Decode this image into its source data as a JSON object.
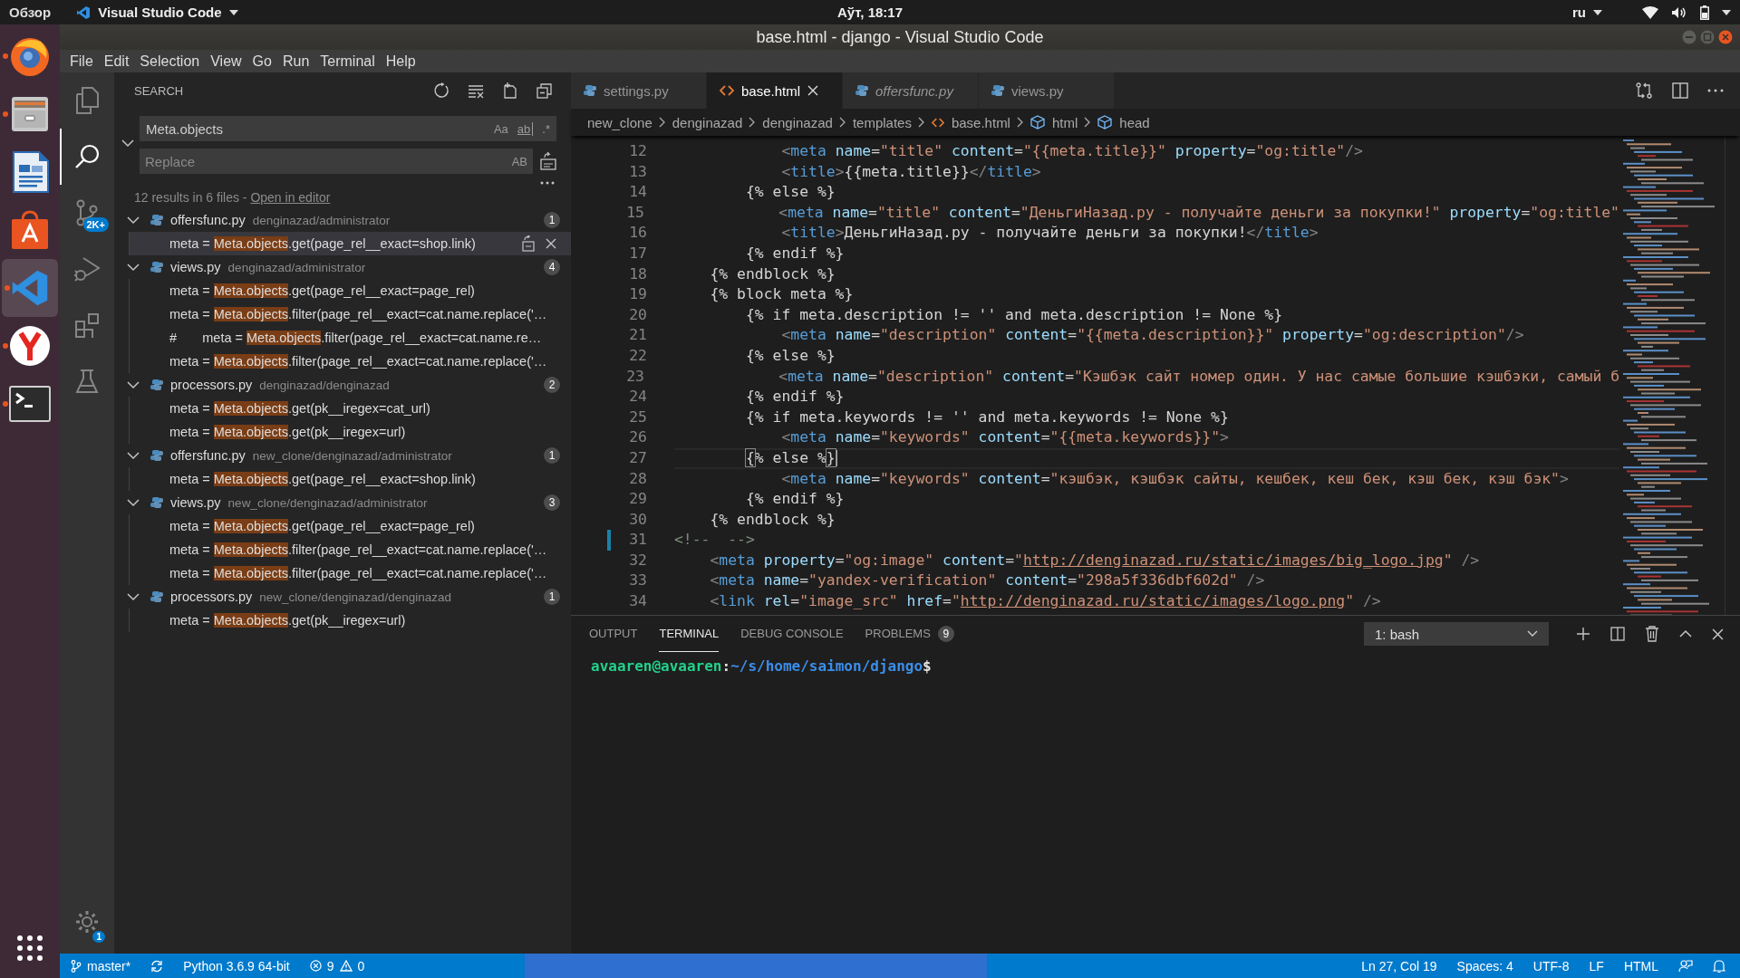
{
  "top_bar": {
    "activities": "Обзор",
    "app_menu": "Visual Studio Code",
    "clock": "Аўт, 18:17",
    "keyboard_layout": "ru"
  },
  "dock": [
    {
      "kind": "browser",
      "running": true,
      "selected": false
    },
    {
      "kind": "files",
      "running": true,
      "selected": false
    },
    {
      "kind": "writer",
      "running": false,
      "selected": false
    },
    {
      "kind": "store",
      "running": false,
      "selected": false
    },
    {
      "kind": "editor",
      "running": true,
      "selected": true
    },
    {
      "kind": "browser2",
      "running": true,
      "selected": false
    },
    {
      "kind": "terminal",
      "running": true,
      "selected": false
    }
  ],
  "window": {
    "title": "base.html - django - Visual Studio Code"
  },
  "menu": [
    "File",
    "Edit",
    "Selection",
    "View",
    "Go",
    "Run",
    "Terminal",
    "Help"
  ],
  "activity_bar": [
    {
      "kind": "explorer",
      "selected": false
    },
    {
      "kind": "search",
      "selected": true
    },
    {
      "kind": "source_control",
      "selected": false,
      "badge": "2K+"
    },
    {
      "kind": "run",
      "selected": false
    },
    {
      "kind": "extensions",
      "selected": false
    },
    {
      "kind": "testing",
      "selected": false
    }
  ],
  "manage_badge": "1",
  "search": {
    "title": "SEARCH",
    "query": "Meta.objects",
    "case_option": "Aa",
    "word_option": "ab",
    "regex_option": ".*",
    "replace_placeholder": "Replace",
    "preserve_case_option": "AB",
    "summary": "12 results in 6 files - ",
    "open_link": "Open in editor",
    "groups": [
      {
        "file": "offersfunc.py",
        "path": "denginazad/administrator",
        "count": "1",
        "expanded": true,
        "matches": [
          {
            "prefix": "meta = ",
            "match": "Meta.objects",
            "suffix": ".get(page_rel__exact=shop.link)",
            "selected": true
          }
        ]
      },
      {
        "file": "views.py",
        "path": "denginazad/administrator",
        "count": "4",
        "expanded": true,
        "matches": [
          {
            "prefix": "meta = ",
            "match": "Meta.objects",
            "suffix": ".get(page_rel__exact=page_rel)",
            "selected": false
          },
          {
            "prefix": "meta = ",
            "match": "Meta.objects",
            "suffix": ".filter(page_rel__exact=cat.name.replace('…",
            "selected": false
          },
          {
            "prefix": "#       meta = ",
            "match": "Meta.objects",
            "suffix": ".filter(page_rel__exact=cat.name.re…",
            "selected": false
          },
          {
            "prefix": "meta = ",
            "match": "Meta.objects",
            "suffix": ".filter(page_rel__exact=cat.name.replace('…",
            "selected": false
          }
        ]
      },
      {
        "file": "processors.py",
        "path": "denginazad/denginazad",
        "count": "2",
        "expanded": true,
        "matches": [
          {
            "prefix": "meta = ",
            "match": "Meta.objects",
            "suffix": ".get(pk__iregex=cat_url)",
            "selected": false
          },
          {
            "prefix": "meta = ",
            "match": "Meta.objects",
            "suffix": ".get(pk__iregex=url)",
            "selected": false
          }
        ]
      },
      {
        "file": "offersfunc.py",
        "path": "new_clone/denginazad/administrator",
        "count": "1",
        "expanded": true,
        "matches": [
          {
            "prefix": "meta = ",
            "match": "Meta.objects",
            "suffix": ".get(page_rel__exact=shop.link)",
            "selected": false
          }
        ]
      },
      {
        "file": "views.py",
        "path": "new_clone/denginazad/administrator",
        "count": "3",
        "expanded": true,
        "matches": [
          {
            "prefix": "meta = ",
            "match": "Meta.objects",
            "suffix": ".get(page_rel__exact=page_rel)",
            "selected": false
          },
          {
            "prefix": "meta = ",
            "match": "Meta.objects",
            "suffix": ".filter(page_rel__exact=cat.name.replace('…",
            "selected": false
          },
          {
            "prefix": "meta = ",
            "match": "Meta.objects",
            "suffix": ".filter(page_rel__exact=cat.name.replace('…",
            "selected": false
          }
        ]
      },
      {
        "file": "processors.py",
        "path": "new_clone/denginazad/denginazad",
        "count": "1",
        "expanded": true,
        "matches": [
          {
            "prefix": "meta = ",
            "match": "Meta.objects",
            "suffix": ".get(pk__iregex=url)",
            "selected": false
          }
        ]
      }
    ]
  },
  "tabs": [
    {
      "label": "settings.py",
      "kind": "python",
      "selected": false,
      "preview": false
    },
    {
      "label": "base.html",
      "kind": "html",
      "selected": true,
      "preview": false
    },
    {
      "label": "offersfunc.py",
      "kind": "python",
      "selected": false,
      "preview": true
    },
    {
      "label": "views.py",
      "kind": "python",
      "selected": false,
      "preview": false
    }
  ],
  "breadcrumbs": [
    {
      "label": "new_clone",
      "kind": "folder"
    },
    {
      "label": "denginazad",
      "kind": "folder"
    },
    {
      "label": "denginazad",
      "kind": "folder"
    },
    {
      "label": "templates",
      "kind": "folder"
    },
    {
      "label": "base.html",
      "kind": "html"
    },
    {
      "label": "html",
      "kind": "element"
    },
    {
      "label": "head",
      "kind": "element"
    }
  ],
  "editor": {
    "lines": [
      {
        "number": "12",
        "current": false,
        "changed": false,
        "tokens": [
          {
            "kind": "punct",
            "text": "            <"
          },
          {
            "kind": "tag",
            "text": "meta"
          },
          {
            "kind": "attr",
            "text": " name"
          },
          {
            "kind": "text",
            "text": "="
          },
          {
            "kind": "string",
            "text": "\"title\""
          },
          {
            "kind": "attr",
            "text": " content"
          },
          {
            "kind": "text",
            "text": "="
          },
          {
            "kind": "string",
            "text": "\"{{meta.title}}\""
          },
          {
            "kind": "attr",
            "text": " property"
          },
          {
            "kind": "text",
            "text": "="
          },
          {
            "kind": "string",
            "text": "\"og:title\""
          },
          {
            "kind": "punct",
            "text": "/>"
          }
        ]
      },
      {
        "number": "13",
        "current": false,
        "changed": false,
        "tokens": [
          {
            "kind": "punct",
            "text": "            <"
          },
          {
            "kind": "tag",
            "text": "title"
          },
          {
            "kind": "punct",
            "text": ">"
          },
          {
            "kind": "text",
            "text": "{{meta.title}}"
          },
          {
            "kind": "punct",
            "text": "</"
          },
          {
            "kind": "tag",
            "text": "title"
          },
          {
            "kind": "punct",
            "text": ">"
          }
        ]
      },
      {
        "number": "14",
        "current": false,
        "changed": false,
        "tokens": [
          {
            "kind": "text",
            "text": "        {% else %}"
          }
        ]
      },
      {
        "number": "15",
        "current": false,
        "changed": false,
        "tokens": [
          {
            "kind": "punct",
            "text": "            <"
          },
          {
            "kind": "tag",
            "text": "meta"
          },
          {
            "kind": "attr",
            "text": " name"
          },
          {
            "kind": "text",
            "text": "="
          },
          {
            "kind": "string",
            "text": "\"title\""
          },
          {
            "kind": "attr",
            "text": " content"
          },
          {
            "kind": "text",
            "text": "="
          },
          {
            "kind": "string",
            "text": "\"ДеньгиНазад.ру - получайте деньги за покупки!\""
          },
          {
            "kind": "attr",
            "text": " property"
          },
          {
            "kind": "text",
            "text": "="
          },
          {
            "kind": "string",
            "text": "\"og:title\""
          }
        ]
      },
      {
        "number": "16",
        "current": false,
        "changed": false,
        "tokens": [
          {
            "kind": "punct",
            "text": "            <"
          },
          {
            "kind": "tag",
            "text": "title"
          },
          {
            "kind": "punct",
            "text": ">"
          },
          {
            "kind": "text",
            "text": "ДеньгиНазад.ру - получайте деньги за покупки!"
          },
          {
            "kind": "punct",
            "text": "</"
          },
          {
            "kind": "tag",
            "text": "title"
          },
          {
            "kind": "punct",
            "text": ">"
          }
        ]
      },
      {
        "number": "17",
        "current": false,
        "changed": false,
        "tokens": [
          {
            "kind": "text",
            "text": "        {% endif %}"
          }
        ]
      },
      {
        "number": "18",
        "current": false,
        "changed": false,
        "tokens": [
          {
            "kind": "text",
            "text": "    {% endblock %}"
          }
        ]
      },
      {
        "number": "19",
        "current": false,
        "changed": false,
        "tokens": [
          {
            "kind": "text",
            "text": "    {% block meta %}"
          }
        ]
      },
      {
        "number": "20",
        "current": false,
        "changed": false,
        "tokens": [
          {
            "kind": "text",
            "text": "        {% if meta.description != '' and meta.description != None %}"
          }
        ]
      },
      {
        "number": "21",
        "current": false,
        "changed": false,
        "tokens": [
          {
            "kind": "punct",
            "text": "            <"
          },
          {
            "kind": "tag",
            "text": "meta"
          },
          {
            "kind": "attr",
            "text": " name"
          },
          {
            "kind": "text",
            "text": "="
          },
          {
            "kind": "string",
            "text": "\"description\""
          },
          {
            "kind": "attr",
            "text": " content"
          },
          {
            "kind": "text",
            "text": "="
          },
          {
            "kind": "string",
            "text": "\"{{meta.description}}\""
          },
          {
            "kind": "attr",
            "text": " property"
          },
          {
            "kind": "text",
            "text": "="
          },
          {
            "kind": "string",
            "text": "\"og:description\""
          },
          {
            "kind": "punct",
            "text": "/>"
          }
        ]
      },
      {
        "number": "22",
        "current": false,
        "changed": false,
        "tokens": [
          {
            "kind": "text",
            "text": "        {% else %}"
          }
        ]
      },
      {
        "number": "23",
        "current": false,
        "changed": false,
        "tokens": [
          {
            "kind": "punct",
            "text": "            <"
          },
          {
            "kind": "tag",
            "text": "meta"
          },
          {
            "kind": "attr",
            "text": " name"
          },
          {
            "kind": "text",
            "text": "="
          },
          {
            "kind": "string",
            "text": "\"description\""
          },
          {
            "kind": "attr",
            "text": " content"
          },
          {
            "kind": "text",
            "text": "="
          },
          {
            "kind": "string",
            "text": "\"Кэшбэк сайт номер один. У нас самые большие кэшбэки, самый б"
          }
        ]
      },
      {
        "number": "24",
        "current": false,
        "changed": false,
        "tokens": [
          {
            "kind": "text",
            "text": "        {% endif %}"
          }
        ]
      },
      {
        "number": "25",
        "current": false,
        "changed": false,
        "tokens": [
          {
            "kind": "text",
            "text": "        {% if meta.keywords != '' and meta.keywords != None %}"
          }
        ]
      },
      {
        "number": "26",
        "current": false,
        "changed": false,
        "tokens": [
          {
            "kind": "punct",
            "text": "            <"
          },
          {
            "kind": "tag",
            "text": "meta"
          },
          {
            "kind": "attr",
            "text": " name"
          },
          {
            "kind": "text",
            "text": "="
          },
          {
            "kind": "string",
            "text": "\"keywords\""
          },
          {
            "kind": "attr",
            "text": " content"
          },
          {
            "kind": "text",
            "text": "="
          },
          {
            "kind": "string",
            "text": "\"{{meta.keywords}}\""
          },
          {
            "kind": "punct",
            "text": ">"
          }
        ]
      },
      {
        "number": "27",
        "current": true,
        "changed": false,
        "tokens": [
          {
            "kind": "bracket",
            "text": "        {"
          },
          {
            "kind": "text",
            "text": "% else %"
          },
          {
            "kind": "bracket",
            "text": "}"
          }
        ]
      },
      {
        "number": "28",
        "current": false,
        "changed": false,
        "tokens": [
          {
            "kind": "punct",
            "text": "            <"
          },
          {
            "kind": "tag",
            "text": "meta"
          },
          {
            "kind": "attr",
            "text": " name"
          },
          {
            "kind": "text",
            "text": "="
          },
          {
            "kind": "string",
            "text": "\"keywords\""
          },
          {
            "kind": "attr",
            "text": " content"
          },
          {
            "kind": "text",
            "text": "="
          },
          {
            "kind": "string",
            "text": "\"кэшбэк, кэшбэк сайты, кешбек, кеш бек, кэш бек, кэш бэк\""
          },
          {
            "kind": "punct",
            "text": ">"
          }
        ]
      },
      {
        "number": "29",
        "current": false,
        "changed": false,
        "tokens": [
          {
            "kind": "text",
            "text": "        {% endif %}"
          }
        ]
      },
      {
        "number": "30",
        "current": false,
        "changed": false,
        "tokens": [
          {
            "kind": "text",
            "text": "    {% endblock %}"
          }
        ]
      },
      {
        "number": "31",
        "current": false,
        "changed": true,
        "tokens": [
          {
            "kind": "comment",
            "text": "<!--  -->"
          }
        ]
      },
      {
        "number": "32",
        "current": false,
        "changed": false,
        "tokens": [
          {
            "kind": "punct",
            "text": "    <"
          },
          {
            "kind": "tag",
            "text": "meta"
          },
          {
            "kind": "attr",
            "text": " property"
          },
          {
            "kind": "text",
            "text": "="
          },
          {
            "kind": "string",
            "text": "\"og:image\""
          },
          {
            "kind": "attr",
            "text": " content"
          },
          {
            "kind": "text",
            "text": "="
          },
          {
            "kind": "string",
            "text": "\""
          },
          {
            "kind": "link",
            "text": "http://denginazad.ru/static/images/big_logo.jpg"
          },
          {
            "kind": "string",
            "text": "\""
          },
          {
            "kind": "punct",
            "text": " />"
          }
        ]
      },
      {
        "number": "33",
        "current": false,
        "changed": false,
        "tokens": [
          {
            "kind": "punct",
            "text": "    <"
          },
          {
            "kind": "tag",
            "text": "meta"
          },
          {
            "kind": "attr",
            "text": " name"
          },
          {
            "kind": "text",
            "text": "="
          },
          {
            "kind": "string",
            "text": "\"yandex-verification\""
          },
          {
            "kind": "attr",
            "text": " content"
          },
          {
            "kind": "text",
            "text": "="
          },
          {
            "kind": "string",
            "text": "\"298a5f336dbf602d\""
          },
          {
            "kind": "punct",
            "text": " />"
          }
        ]
      },
      {
        "number": "34",
        "current": false,
        "changed": false,
        "tokens": [
          {
            "kind": "punct",
            "text": "    <"
          },
          {
            "kind": "tag",
            "text": "link"
          },
          {
            "kind": "attr",
            "text": " rel"
          },
          {
            "kind": "text",
            "text": "="
          },
          {
            "kind": "string",
            "text": "\"image_src\""
          },
          {
            "kind": "attr",
            "text": " href"
          },
          {
            "kind": "text",
            "text": "="
          },
          {
            "kind": "string",
            "text": "\""
          },
          {
            "kind": "link",
            "text": "http://denginazad.ru/static/images/logo.png"
          },
          {
            "kind": "string",
            "text": "\""
          },
          {
            "kind": "punct",
            "text": " />"
          }
        ]
      }
    ]
  },
  "panel": {
    "tabs": [
      {
        "label": "OUTPUT",
        "selected": false
      },
      {
        "label": "TERMINAL",
        "selected": true
      },
      {
        "label": "DEBUG CONSOLE",
        "selected": false
      },
      {
        "label": "PROBLEMS",
        "selected": false,
        "badge": "9"
      }
    ],
    "terminal_select": "1: bash",
    "prompt": {
      "user": "avaaren@avaaren",
      "separator": ":",
      "path": "~/s/home/saimon/django",
      "symbol": "$"
    }
  },
  "status_bar": {
    "branch": "master*",
    "interpreter": "Python 3.6.9 64-bit",
    "errors": "9",
    "warnings": "0",
    "position": "Ln 27, Col 19",
    "indentation": "Spaces: 4",
    "encoding": "UTF-8",
    "line_ending": "LF",
    "language": "HTML"
  }
}
